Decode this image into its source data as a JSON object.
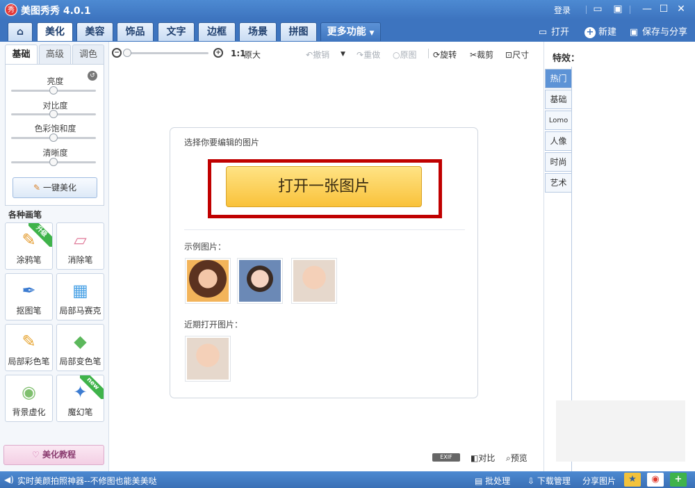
{
  "window": {
    "logo": "秀",
    "title": "美图秀秀 4.0.1",
    "login_label": "登录"
  },
  "nav": {
    "tabs": [
      "美化",
      "美容",
      "饰品",
      "文字",
      "边框",
      "场景",
      "拼图"
    ],
    "more_label": "更多功能",
    "open_label": "打开",
    "new_label": "新建",
    "save_label": "保存与分享"
  },
  "left": {
    "subtabs": [
      "基础",
      "高级",
      "调色"
    ],
    "sliders": [
      {
        "label": "亮度",
        "value": 0.5
      },
      {
        "label": "对比度",
        "value": 0.5
      },
      {
        "label": "色彩饱和度",
        "value": 0.5
      },
      {
        "label": "清晰度",
        "value": 0.5
      }
    ],
    "one_click_label": "一键美化",
    "brush_heading": "各种画笔",
    "tools": [
      "涂鸦笔",
      "消除笔",
      "抠图笔",
      "局部马赛克",
      "局部彩色笔",
      "局部变色笔",
      "背景虚化",
      "魔幻笔"
    ],
    "badge_upgrade": "升级",
    "badge_new": "new",
    "tutorial_label": "美化教程"
  },
  "toolbar": {
    "zoom_value": 0.0,
    "ratio_label": "1:1",
    "original_size_label": "原大",
    "undo_label": "撤销",
    "redo_label": "重做",
    "original_label": "原图",
    "rotate_label": "旋转",
    "crop_label": "裁剪",
    "size_label": "尺寸"
  },
  "card": {
    "prompt": "选择你要编辑的图片",
    "open_button": "打开一张图片",
    "samples_label": "示例图片：",
    "recent_label": "近期打开图片："
  },
  "right": {
    "title": "特效：",
    "tabs": [
      "热门",
      "基础",
      "Lomo",
      "人像",
      "时尚",
      "艺术"
    ]
  },
  "bottom": {
    "exif_label": "EXIF",
    "compare_label": "对比",
    "preview_label": "预览"
  },
  "status": {
    "promo_text": "实时美颜拍照神器--不修图也能美美哒",
    "batch_label": "批处理",
    "download_label": "下载管理",
    "share_label": "分享图片"
  },
  "colors": {
    "accent": "#3d74bf",
    "highlight_frame": "#c00000",
    "open_button": "#f9c23a"
  }
}
